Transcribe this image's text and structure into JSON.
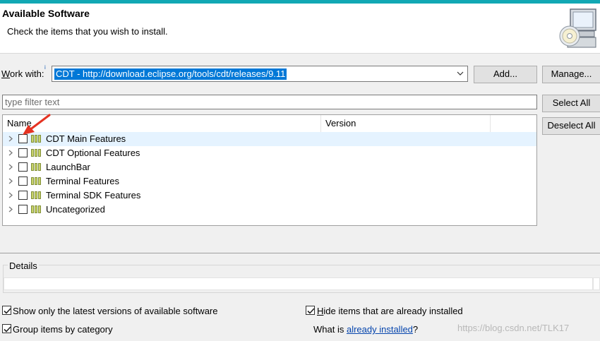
{
  "header": {
    "title": "Available Software",
    "subtitle": "Check the items that you wish to install."
  },
  "work_with": {
    "label_prefix": "W",
    "label_rest": "ork with:",
    "info_mark": "i",
    "value": "CDT - http://download.eclipse.org/tools/cdt/releases/9.11",
    "add_button": "Add...",
    "manage_button": "Manage..."
  },
  "filter": {
    "placeholder": "type filter text"
  },
  "buttons": {
    "select_all": "Select All",
    "deselect_all": "Deselect All"
  },
  "tree": {
    "columns": {
      "name": "Name",
      "version": "Version"
    },
    "items": [
      {
        "label": "CDT Main Features",
        "checked": false,
        "highlighted": true
      },
      {
        "label": "CDT Optional Features",
        "checked": false
      },
      {
        "label": "LaunchBar",
        "checked": false
      },
      {
        "label": "Terminal Features",
        "checked": false
      },
      {
        "label": "Terminal SDK Features",
        "checked": false
      },
      {
        "label": "Uncategorized",
        "checked": false
      }
    ]
  },
  "details": {
    "label": "Details",
    "value": ""
  },
  "options": {
    "show_latest": {
      "label": "Show only the latest versions of available software",
      "checked": true
    },
    "group_by_category": {
      "label": "Group items by category",
      "checked": true
    },
    "hide_installed": {
      "label_prefix": "H",
      "label_rest": "ide items that are already installed",
      "checked": true
    },
    "what_is": {
      "before": "What is ",
      "link": "already installed",
      "after": "?"
    }
  },
  "watermark": "https://blog.csdn.net/TLK17",
  "icons": [
    "cd-install-icon",
    "info-icon",
    "dropdown-arrow-icon",
    "expand-chevron-icon",
    "package-icon",
    "red-pointer-arrow"
  ],
  "colors": {
    "accent_bar": "#12a8b4",
    "selection": "#0078d7",
    "annotation_arrow": "#e53322",
    "row_highlight": "#e5f3ff"
  }
}
